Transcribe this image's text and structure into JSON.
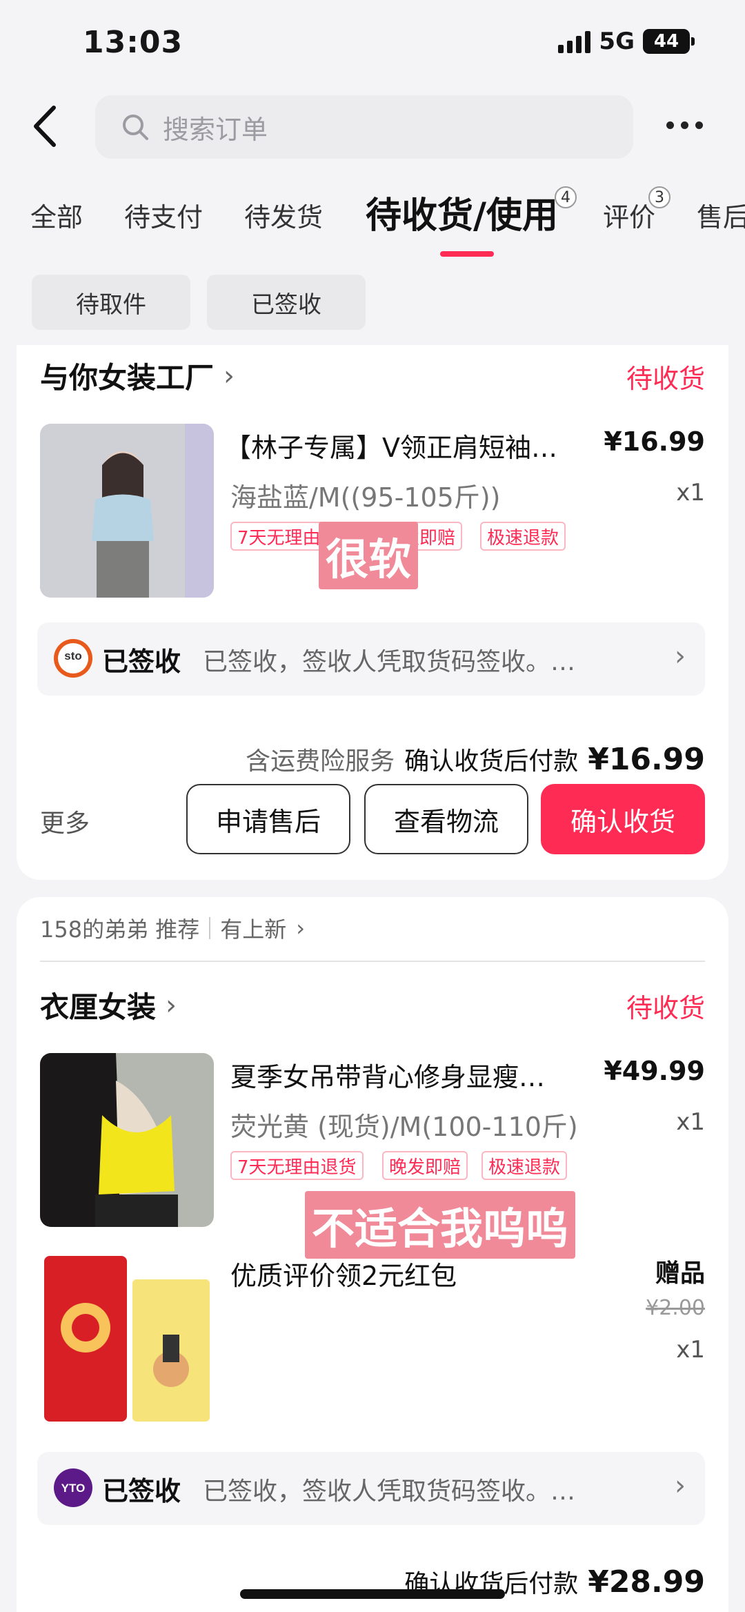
{
  "status_bar": {
    "time": "13:03",
    "network": "5G",
    "battery": "44"
  },
  "header": {
    "search_placeholder": "搜索订单"
  },
  "tabs": [
    {
      "label": "全部"
    },
    {
      "label": "待支付"
    },
    {
      "label": "待发货"
    },
    {
      "label": "待收货/使用",
      "badge": "4",
      "active": true
    },
    {
      "label": "评价",
      "badge": "3"
    },
    {
      "label": "售后"
    }
  ],
  "sub_filters": [
    "待取件",
    "已签收"
  ],
  "orders": [
    {
      "shop": "与你女装工厂",
      "status": "待收货",
      "product": {
        "title": "【林子专属】V领正肩短袖…",
        "spec": "海盐蓝/M((95-105斤))",
        "price": "¥16.99",
        "qty": "x1",
        "tags": [
          "7天无理由退货",
          "晚发即赔",
          "极速退款"
        ],
        "overlay_text": "很软"
      },
      "logistics": {
        "carrier_logo": "sto",
        "status": "已签收",
        "desc": "已签收，签收人凭取货码签收。…"
      },
      "summary": {
        "service": "含运费险服务",
        "pay_label": "确认收货后付款",
        "amount": "¥16.99"
      },
      "actions": {
        "more": "更多",
        "after_sale": "申请售后",
        "logistics": "查看物流",
        "confirm": "确认收货"
      }
    },
    {
      "recommend": {
        "text": "158的弟弟 推荐",
        "new": "有上新"
      },
      "shop": "衣厘女装",
      "status": "待收货",
      "product": {
        "title": "夏季女吊带背心修身显瘦…",
        "spec": "荧光黄 (现货)/M(100-110斤)",
        "price": "¥49.99",
        "qty": "x1",
        "tags": [
          "7天无理由退货",
          "晚发即赔",
          "极速退款"
        ],
        "overlay_text": "不适合我呜呜"
      },
      "gift": {
        "title": "优质评价领2元红包",
        "label": "赠品",
        "price": "¥2.00",
        "qty": "x1"
      },
      "logistics": {
        "carrier_logo": "YTO",
        "status": "已签收",
        "desc": "已签收，签收人凭取货码签收。…"
      },
      "summary": {
        "pay_label": "确认收货后付款",
        "amount": "¥28.99"
      }
    }
  ],
  "colors": {
    "accent": "#fe2c55",
    "background": "#f4f4f6"
  }
}
